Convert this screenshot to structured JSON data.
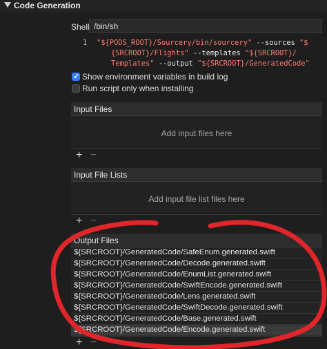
{
  "header": {
    "title": "Code Generation"
  },
  "shell": {
    "label": "Shell",
    "value": "/bin/sh"
  },
  "script": {
    "line_number": "1",
    "lines": [
      [
        {
          "t": "\"${PODS_ROOT}/Sourcery/bin/sourcery\"",
          "c": "s"
        },
        {
          "t": " --sources ",
          "c": "k"
        },
        {
          "t": "\"$",
          "c": "s"
        }
      ],
      [
        {
          "t": "{SRCROOT}/Flights\"",
          "c": "s"
        },
        {
          "t": " --templates ",
          "c": "k"
        },
        {
          "t": "\"${SRCROOT}/",
          "c": "s"
        }
      ],
      [
        {
          "t": "Templates\"",
          "c": "s"
        },
        {
          "t": " --output ",
          "c": "k"
        },
        {
          "t": "\"${SRCROOT}/GeneratedCode\"",
          "c": "s"
        }
      ]
    ]
  },
  "options": {
    "show_env": {
      "label": "Show environment variables in build log",
      "checked": true
    },
    "run_install": {
      "label": "Run script only when installing",
      "checked": false
    }
  },
  "input_files": {
    "title": "Input Files",
    "placeholder": "Add input files here"
  },
  "input_file_lists": {
    "title": "Input File Lists",
    "placeholder": "Add input file list files here"
  },
  "output_files": {
    "title": "Output Files",
    "items": [
      "${SRCROOT}/GeneratedCode/SafeEnum.generated.swift",
      "${SRCROOT}/GeneratedCode/Decode.generated.swift",
      "${SRCROOT}/GeneratedCode/EnumList.generated.swift",
      "${SRCROOT}/GeneratedCode/SwiftEncode.generated.swift",
      "${SRCROOT}/GeneratedCode/Lens.generated.swift",
      "${SRCROOT}/GeneratedCode/SwiftDecode.generated.swift",
      "${SRCROOT}/GeneratedCode/Base.generated.swift",
      "${SRCROOT}/GeneratedCode/Encode.generated.swift"
    ],
    "selected_index": 7
  },
  "controls": {
    "plus": "+",
    "minus": "−"
  },
  "annotation_color": "#e0262a"
}
